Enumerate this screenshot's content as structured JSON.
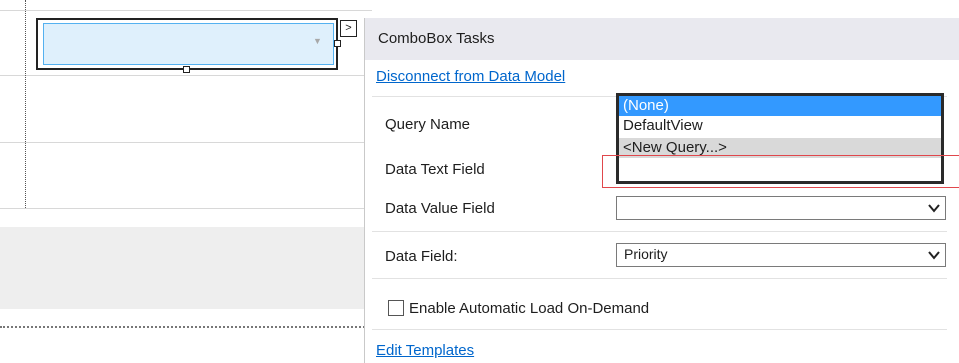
{
  "panel": {
    "title": "ComboBox Tasks",
    "disconnect_link": "Disconnect from Data Model",
    "query_name": {
      "label": "Query Name",
      "options": [
        "(None)",
        "DefaultView",
        "<New Query...>"
      ],
      "selected": "(None)",
      "highlighted": "<New Query...>"
    },
    "data_text_field": {
      "label": "Data Text Field"
    },
    "data_value_field": {
      "label": "Data Value Field",
      "value": ""
    },
    "data_field": {
      "label": "Data Field:",
      "value": "Priority"
    },
    "auto_load": {
      "label": "Enable Automatic Load On-Demand",
      "checked": false
    },
    "edit_templates_link": "Edit Templates"
  },
  "colors": {
    "selection": "#3399ff",
    "hover": "#d9d9d9",
    "link": "#0066cc",
    "combo_fill": "#dff0fc",
    "highlight_outline": "#e0474c"
  },
  "icons": {
    "smart_tag": "chevron-right-icon",
    "combo_arrow": "triangle-down-icon",
    "select_arrow": "chevron-down-icon"
  }
}
